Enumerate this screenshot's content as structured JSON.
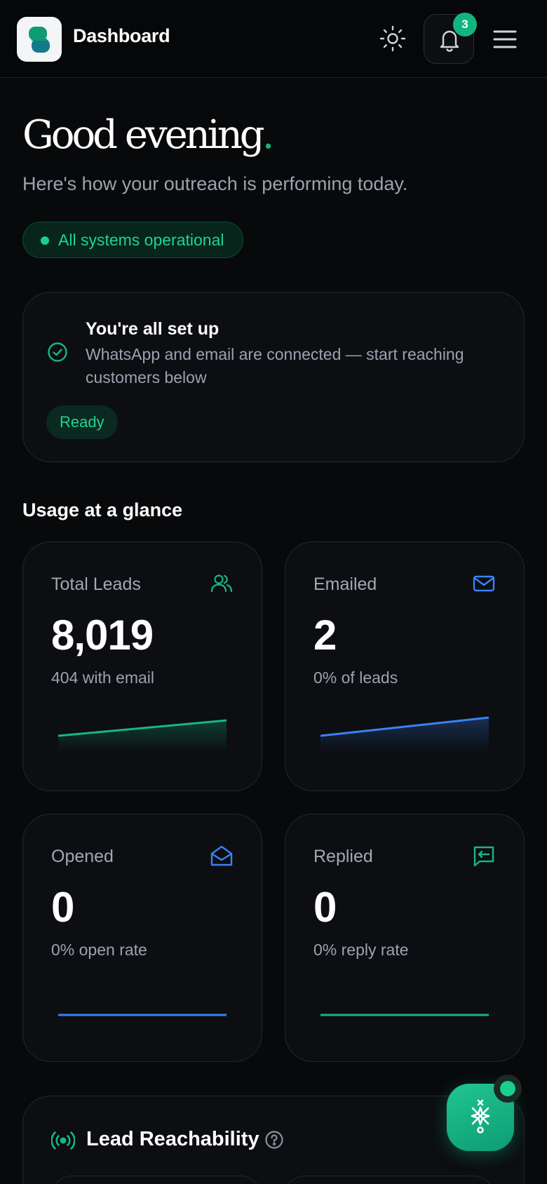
{
  "header": {
    "title": "Dashboard",
    "notification_count": "3",
    "icons": {
      "logo": "chat-bubbles-logo-icon",
      "theme": "sun-icon",
      "notifications": "bell-icon",
      "menu": "hamburger-menu-icon"
    }
  },
  "hero": {
    "greeting": "Good evening",
    "greeting_punct": ".",
    "subtitle": "Here's how your outreach is performing today.",
    "status": "All systems operational"
  },
  "setup": {
    "title": "You're all set up",
    "description": "WhatsApp and email are connected — start reaching customers below",
    "badge": "Ready"
  },
  "usage": {
    "title": "Usage at a glance",
    "cards": [
      {
        "label": "Total Leads",
        "value": "8,019",
        "sub": "404 with email",
        "icon": "users-icon",
        "color": "#16b882",
        "trend": [
          0.3,
          0.85
        ]
      },
      {
        "label": "Emailed",
        "value": "2",
        "sub": "0% of leads",
        "icon": "mail-icon",
        "color": "#3b82f6",
        "trend": [
          0.3,
          0.95
        ]
      },
      {
        "label": "Opened",
        "value": "0",
        "sub": "0% open rate",
        "icon": "mail-open-icon",
        "color": "#3b82f6",
        "trend": [
          0,
          0
        ]
      },
      {
        "label": "Replied",
        "value": "0",
        "sub": "0% reply rate",
        "icon": "message-reply-icon",
        "color": "#16b882",
        "trend": [
          0,
          0
        ]
      }
    ]
  },
  "reachability": {
    "title": "Lead Reachability",
    "icon": "broadcast-icon",
    "help_icon": "question-icon"
  },
  "fab": {
    "icon": "ai-sparkle-icon",
    "accent": "#12b57f"
  }
}
